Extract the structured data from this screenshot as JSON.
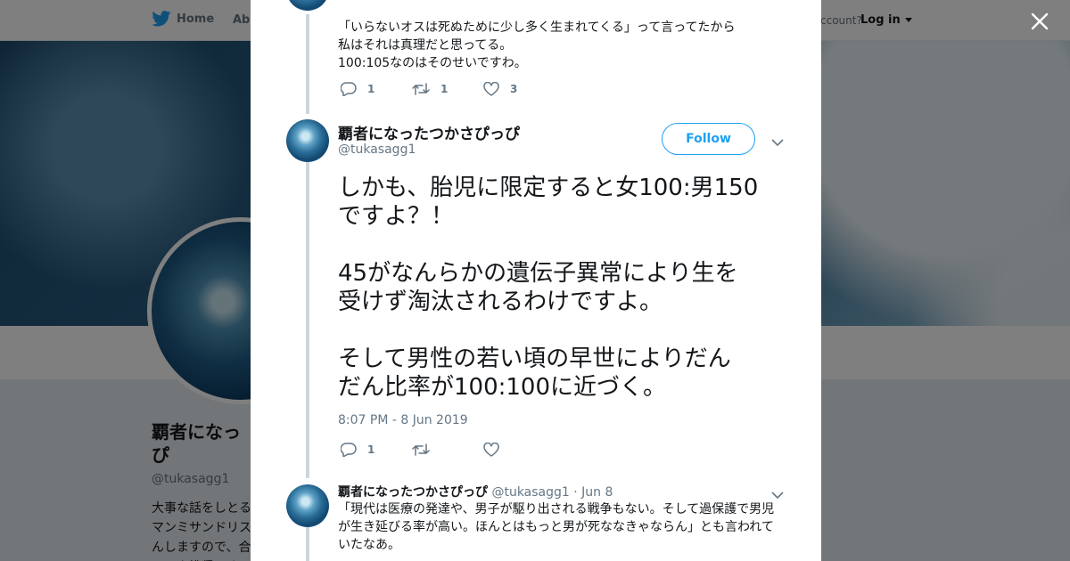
{
  "topbar": {
    "home_label": "Home",
    "about_label": "Abo",
    "account_prompt": "ccount?",
    "login_label": "Log in"
  },
  "profile": {
    "name": "覇者になっ\nぴ",
    "handle": "@tukasagg1",
    "bio": "大事な話をしとる\nマンミサンドリス\nんしますので、合\nロック推奨です。"
  },
  "thread": {
    "prev_tweet": {
      "text": "「いらないオスは死ぬために少し多く生まれてくる」って言ってたから\n私はそれは真理だと思ってる。\n100:105なのはそのせいですわ。",
      "replies": "1",
      "retweets": "1",
      "likes": "3"
    },
    "main_tweet": {
      "name": "覇者になったつかさぴっぴ",
      "handle": "@tukasagg1",
      "follow_label": "Follow",
      "text": "しかも、胎児に限定すると女100:男150\nですよ？！\n\n45がなんらかの遺伝子異常により生を\n受けず淘汰されるわけですよ。\n\nそして男性の若い頃の早世によりだん\nだん比率が100:100に近づく。",
      "timestamp": "8:07 PM - 8 Jun 2019",
      "replies": "1",
      "retweets": "",
      "likes": ""
    },
    "reply_tweet": {
      "name": "覇者になったつかさぴっぴ",
      "handle": "@tukasagg1",
      "separator": "·",
      "date": "Jun 8",
      "text": "「現代は医療の発達や、男子が駆り出される戦争もない。そして過保護で男児\nが生き延びる率が高い。ほんとはもっと男が死ななきゃならん」とも言われて\nいたなあ。"
    }
  },
  "colors": {
    "twitter_blue": "#1da1f2",
    "text_primary": "#14171a",
    "text_secondary": "#657786",
    "thread_line": "#ccd6dd"
  },
  "icons": [
    "twitter-bird-icon",
    "caret-down-icon",
    "close-icon",
    "reply-icon",
    "retweet-icon",
    "like-icon",
    "chevron-down-icon"
  ]
}
